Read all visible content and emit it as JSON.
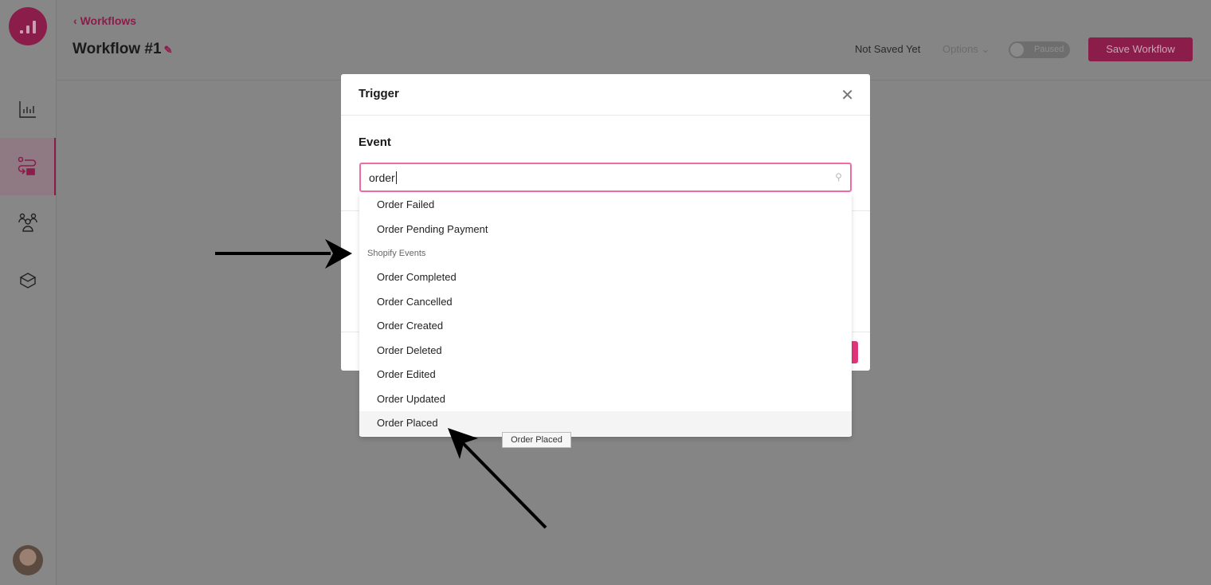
{
  "header": {
    "back_label": "Workflows",
    "title": "Workflow #1",
    "save_status": "Not Saved Yet",
    "options_label": "Options",
    "toggle_label": "Paused",
    "save_button": "Save Workflow"
  },
  "modal": {
    "title": "Trigger",
    "event_label": "Event",
    "search_value": "order",
    "options_top": [
      "Order Failed",
      "Order Pending Payment"
    ],
    "group_label": "Shopify Events",
    "options_group": [
      "Order Completed",
      "Order Cancelled",
      "Order Created",
      "Order Deleted",
      "Order Edited",
      "Order Updated",
      "Order Placed"
    ],
    "highlighted": "Order Placed",
    "tooltip": "Order Placed"
  },
  "colors": {
    "accent": "#8a1d4a",
    "modal_accent": "#e0357a"
  }
}
